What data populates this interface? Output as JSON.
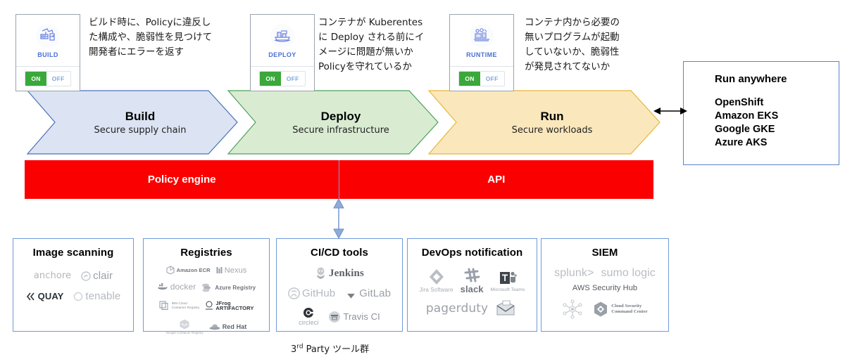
{
  "stages": [
    {
      "icon": "build-robot-icon",
      "label": "BUILD",
      "toggle_on": "ON",
      "toggle_off": "OFF",
      "description": "ビルド時に、Policyに違反し\nた構成や、脆弱性を見つけて\n開発者にエラーを返す"
    },
    {
      "icon": "deploy-ship-icon",
      "label": "DEPLOY",
      "toggle_on": "ON",
      "toggle_off": "OFF",
      "description": "コンテナが Kuberentes\nに Deploy される前にイ\nメージに問題が無いか\nPolicyを守れているか"
    },
    {
      "icon": "runtime-gear-icon",
      "label": "RUNTIME",
      "toggle_on": "ON",
      "toggle_off": "OFF",
      "description": "コンテナ内から必要の\n無いプログラムが起動\nしていないか、脆弱性\nが発見されてないか"
    }
  ],
  "chevrons": [
    {
      "title": "Build",
      "subtitle": "Secure supply chain",
      "fill": "#dce3f2",
      "stroke": "#4a72b8"
    },
    {
      "title": "Deploy",
      "subtitle": "Secure infrastructure",
      "fill": "#d9ecd2",
      "stroke": "#4ca15c"
    },
    {
      "title": "Run",
      "subtitle": "Secure workloads",
      "fill": "#fae8bc",
      "stroke": "#e8b53c"
    }
  ],
  "redbar": {
    "left_label": "Policy engine",
    "right_label": "API",
    "color": "#fb0000"
  },
  "run_anywhere": {
    "title": "Run anywhere",
    "items": [
      "OpenShift",
      "Amazon EKS",
      "Google GKE",
      "Azure AKS"
    ],
    "border_color": "#5b84c4"
  },
  "panels": [
    {
      "title": "Image scanning",
      "logos": [
        {
          "name": "anchore-logo",
          "text": "anchore",
          "icon": "none"
        },
        {
          "name": "clair-logo",
          "text": "clair",
          "icon": "circle-swirl"
        },
        {
          "name": "quay-logo",
          "text": "QUAY",
          "icon": "double-chevron"
        },
        {
          "name": "tenable-logo",
          "text": "tenable",
          "icon": "ring"
        }
      ]
    },
    {
      "title": "Registries",
      "logos": [
        {
          "name": "amazon-ecr-logo",
          "text": "Amazon ECR",
          "icon": "cube"
        },
        {
          "name": "nexus-logo",
          "text": "Nexus",
          "icon": "bars"
        },
        {
          "name": "docker-logo",
          "text": "docker",
          "icon": "whale"
        },
        {
          "name": "azure-registry-logo",
          "text": "Azure Registry",
          "icon": "stack"
        },
        {
          "name": "ibm-cloud-registry-logo",
          "text": "IBM Cloud\nContainer Registry",
          "icon": "boxes"
        },
        {
          "name": "jfrog-artifactory-logo",
          "text": "JFrog\nARTIFACTORY",
          "icon": "ring"
        },
        {
          "name": "google-container-registry-logo",
          "text": "Google Container Registry",
          "icon": "hexagon"
        },
        {
          "name": "red-hat-logo",
          "text": "Red Hat",
          "icon": "hat"
        }
      ]
    },
    {
      "title": "CI/CD tools",
      "logos": [
        {
          "name": "jenkins-logo",
          "text": "Jenkins",
          "icon": "butler"
        },
        {
          "name": "github-logo",
          "text": "GitHub",
          "icon": "octocat"
        },
        {
          "name": "gitlab-logo",
          "text": "GitLab",
          "icon": "fox"
        },
        {
          "name": "circleci-logo",
          "text": "circleci",
          "icon": "target"
        },
        {
          "name": "travisci-logo",
          "text": "Travis CI",
          "icon": "badge"
        }
      ]
    },
    {
      "title": "DevOps notification",
      "logos": [
        {
          "name": "jira-logo",
          "text": "Jira Software",
          "icon": "diamond"
        },
        {
          "name": "slack-logo",
          "text": "slack",
          "icon": "hash"
        },
        {
          "name": "teams-logo",
          "text": "Microsoft Teams",
          "icon": "teams-t"
        },
        {
          "name": "pagerduty-logo",
          "text": "pagerduty",
          "icon": "none"
        },
        {
          "name": "email-logo",
          "text": "",
          "icon": "envelope"
        }
      ]
    },
    {
      "title": "SIEM",
      "logos": [
        {
          "name": "splunk-logo",
          "text": "splunk>",
          "icon": "none"
        },
        {
          "name": "sumo-logic-logo",
          "text": "sumo logic",
          "icon": "none"
        },
        {
          "name": "aws-security-hub-logo",
          "text": "AWS Security Hub",
          "icon": "none"
        },
        {
          "name": "azure-sentinel-logo",
          "text": "",
          "icon": "network"
        },
        {
          "name": "cloud-security-command-center-logo",
          "text": "Cloud Security\nCommand Center",
          "icon": "hexagon-diamond"
        }
      ]
    }
  ],
  "caption": "3rd Party ツール群",
  "caption_sup": "rd"
}
